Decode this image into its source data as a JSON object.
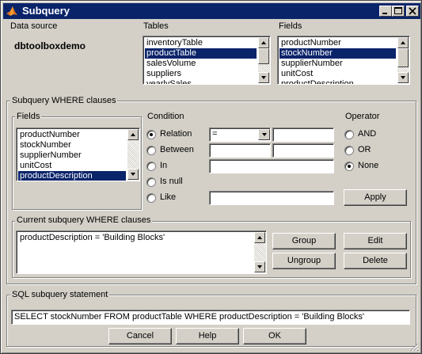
{
  "window": {
    "title": "Subquery",
    "minimize": "_",
    "maximize": "□",
    "close": "×"
  },
  "data_source": {
    "label": "Data source",
    "value": "dbtoolboxdemo"
  },
  "tables": {
    "label": "Tables",
    "items": [
      "inventoryTable",
      "productTable",
      "salesVolume",
      "suppliers",
      "yearlySales"
    ],
    "selected": "productTable"
  },
  "fields_top": {
    "label": "Fields",
    "items": [
      "productNumber",
      "stockNumber",
      "supplierNumber",
      "unitCost",
      "productDescription"
    ],
    "selected": "stockNumber"
  },
  "where": {
    "group_label": "Subquery WHERE clauses",
    "fields_label": "Fields",
    "fields": [
      "productNumber",
      "stockNumber",
      "supplierNumber",
      "unitCost",
      "productDescription"
    ],
    "selected_field": "productDescription",
    "condition_label": "Condition",
    "conditions": [
      "Relation",
      "Between",
      "In",
      "Is null",
      "Like"
    ],
    "selected_condition": "Relation",
    "relation_operator": "=",
    "operator_label": "Operator",
    "operators": [
      "AND",
      "OR",
      "None"
    ],
    "selected_operator": "None",
    "apply": "Apply"
  },
  "current": {
    "group_label": "Current subquery WHERE clauses",
    "clause": "productDescription = 'Building Blocks'",
    "group": "Group",
    "edit": "Edit",
    "ungroup": "Ungroup",
    "delete": "Delete"
  },
  "sql": {
    "group_label": "SQL subquery statement",
    "statement": "SELECT stockNumber FROM productTable WHERE productDescription = 'Building Blocks'"
  },
  "buttons": {
    "cancel": "Cancel",
    "help": "Help",
    "ok": "OK"
  },
  "colors": {
    "title_bar": "#0a246a",
    "selection": "#0a246a",
    "face": "#d4d0c8"
  },
  "icons": {
    "app": "matlab-logo-icon"
  }
}
